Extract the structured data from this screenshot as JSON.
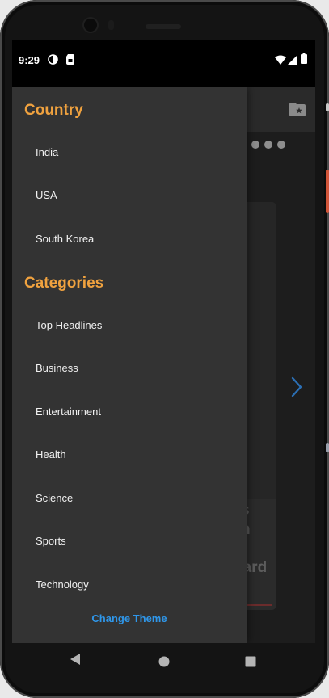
{
  "status_bar": {
    "time": "9:29",
    "left_icons": [
      "circle-half-icon",
      "sim-card-icon"
    ],
    "right_icons": [
      "wifi-icon",
      "signal-icon",
      "battery-icon"
    ]
  },
  "drawer": {
    "country_title": "Country",
    "countries": [
      {
        "label": "India"
      },
      {
        "label": "USA"
      },
      {
        "label": "South Korea"
      }
    ],
    "categories_title": "Categories",
    "categories": [
      {
        "label": "Top Headlines"
      },
      {
        "label": "Business"
      },
      {
        "label": "Entertainment"
      },
      {
        "label": "Health"
      },
      {
        "label": "Science"
      },
      {
        "label": "Sports"
      },
      {
        "label": "Technology"
      }
    ],
    "change_theme_label": "Change Theme"
  },
  "background": {
    "card_text_line1": "s",
    "card_text_line2": "n",
    "card_text_line3": "uard",
    "icons": [
      "bookmark-star-icon",
      "chevron-right-icon"
    ]
  },
  "colors": {
    "accent": "#f0a23f",
    "link": "#2f97ea",
    "drawer_bg": "#333333"
  },
  "nav_bar": {
    "icons": [
      "back-icon",
      "home-icon",
      "recents-icon"
    ]
  }
}
